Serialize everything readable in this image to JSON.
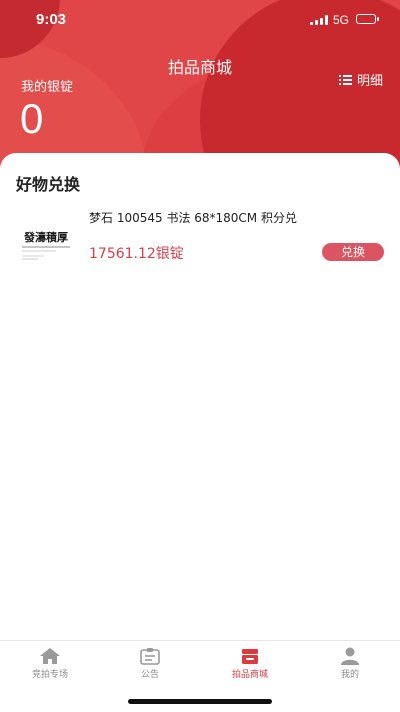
{
  "status_bar": {
    "time": "9:03",
    "network": "5G",
    "battery_level": 1.0
  },
  "header": {
    "title": "拍品商城",
    "detail_label": "明细",
    "balance_label": "我的银锭",
    "balance_value": "0"
  },
  "section": {
    "title": "好物兑换"
  },
  "products": [
    {
      "name": "梦石 100545 书法 68*180CM 积分兑",
      "price": "17561.12银锭",
      "button_label": "兑换",
      "thumb_text": "發濤積厚"
    }
  ],
  "tabs": [
    {
      "label": "竞拍专场",
      "icon": "home-icon",
      "active": false
    },
    {
      "label": "公告",
      "icon": "notice-icon",
      "active": false
    },
    {
      "label": "拍品商城",
      "icon": "store-icon",
      "active": true
    },
    {
      "label": "我的",
      "icon": "person-icon",
      "active": false
    }
  ],
  "colors": {
    "brand_red": "#e04548",
    "price_red": "#d8414b",
    "button_red": "#db5461",
    "tab_active": "#d93b3f",
    "tab_inactive": "#8a8a8a"
  }
}
